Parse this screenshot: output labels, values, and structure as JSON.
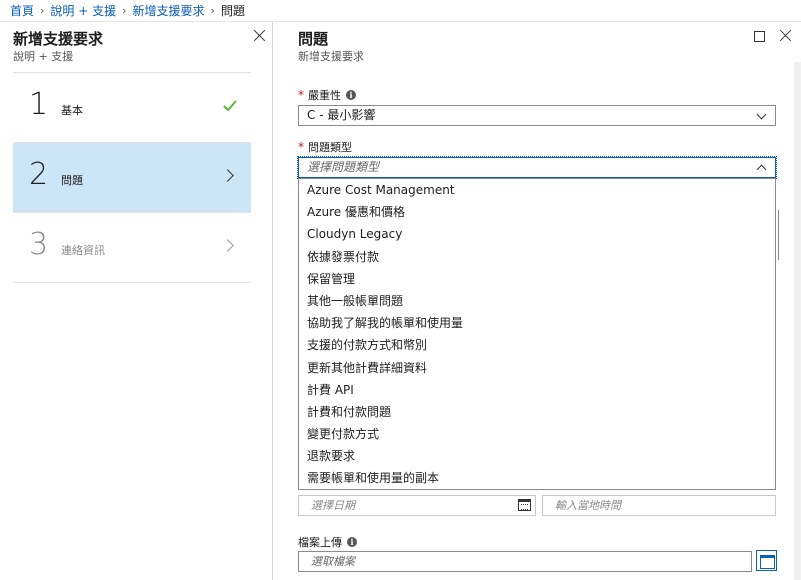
{
  "breadcrumb": {
    "items": [
      "首頁",
      "說明 + 支援",
      "新增支援要求"
    ],
    "current": "問題"
  },
  "left_blade": {
    "title": "新增支援要求",
    "subtitle": "說明 + 支援",
    "steps": [
      {
        "number": "1",
        "label": "基本",
        "status": "completed"
      },
      {
        "number": "2",
        "label": "問題",
        "status": "active"
      },
      {
        "number": "3",
        "label": "連絡資訊",
        "status": "disabled"
      }
    ]
  },
  "right_blade": {
    "title": "問題",
    "subtitle": "新增支援要求",
    "severity": {
      "label": "嚴重性",
      "value": "C - 最小影響"
    },
    "problem_type": {
      "label": "問題類型",
      "placeholder": "選擇問題類型",
      "options": [
        "Azure Cost Management",
        "Azure 優惠和價格",
        "Cloudyn Legacy",
        "依據發票付款",
        "保留管理",
        "其他一般帳單問題",
        "協助我了解我的帳單和使用量",
        "支援的付款方式和幣別",
        "更新其他計費詳細資料",
        "計費 API",
        "計費和付款問題",
        "變更付款方式",
        "退款要求",
        "需要帳單和使用量的副本"
      ]
    },
    "date": {
      "placeholder": "選擇日期"
    },
    "time": {
      "placeholder": "輸入當地時間"
    },
    "file_upload": {
      "label": "檔案上傳",
      "placeholder": "選取檔案"
    }
  },
  "colors": {
    "link": "#0a5fb4",
    "active_step_bg": "#cde6f7",
    "check_green": "#5cb82e",
    "required": "#c41818"
  }
}
